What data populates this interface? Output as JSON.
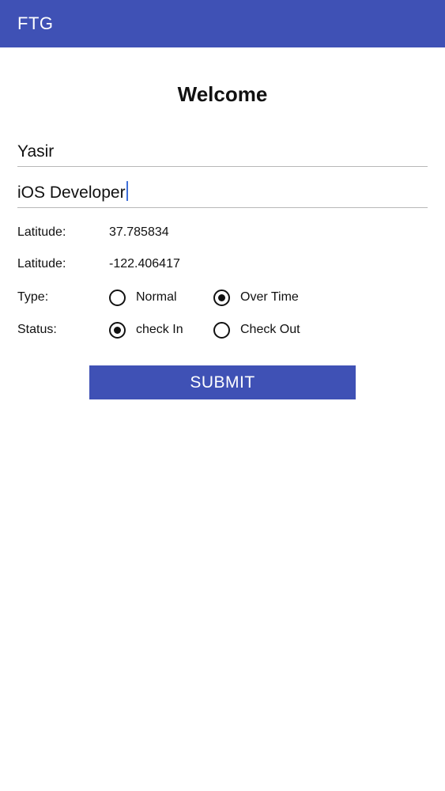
{
  "app_bar": {
    "title": "FTG",
    "color": "#3f51b5"
  },
  "page": {
    "title": "Welcome"
  },
  "fields": {
    "name": {
      "value": "Yasir"
    },
    "role": {
      "value": "iOS Developer"
    }
  },
  "location": {
    "latitude_label": "Latitude:",
    "latitude_value": "37.785834",
    "longitude_label": "Latitude:",
    "longitude_value": "-122.406417"
  },
  "type": {
    "label": "Type:",
    "options": [
      {
        "label": "Normal",
        "selected": false
      },
      {
        "label": "Over Time",
        "selected": true
      }
    ]
  },
  "status": {
    "label": "Status:",
    "options": [
      {
        "label": "check In",
        "selected": true
      },
      {
        "label": "Check Out",
        "selected": false
      }
    ]
  },
  "submit": {
    "label": "SUBMIT"
  }
}
